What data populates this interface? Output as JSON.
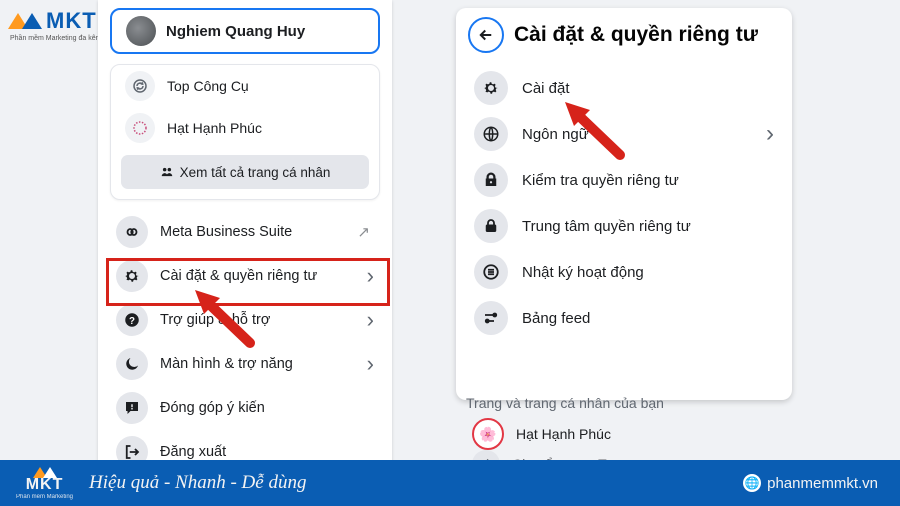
{
  "brand": {
    "name": "MKT",
    "sub": "Phần mềm Marketing đa kênh"
  },
  "left": {
    "profile_name": "Nghiem Quang Huy",
    "quick": [
      {
        "icon": "refresh-circle-icon",
        "label": "Top Công Cụ"
      },
      {
        "icon": "flower-moon-icon",
        "label": "Hạt Hạnh Phúc"
      }
    ],
    "all_profiles": "Xem tất cả trang cá nhân",
    "menu": [
      {
        "icon": "infinity-icon",
        "label": "Meta Business Suite",
        "external": "↗"
      },
      {
        "icon": "gear-icon",
        "label": "Cài đặt & quyền riêng tư",
        "chev": "›"
      },
      {
        "icon": "help-icon",
        "label": "Trợ giúp & hỗ trợ",
        "chev": "›"
      },
      {
        "icon": "moon-icon",
        "label": "Màn hình & trợ năng",
        "chev": "›"
      },
      {
        "icon": "feedback-icon",
        "label": "Đóng góp ý kiến"
      },
      {
        "icon": "logout-icon",
        "label": "Đăng xuất"
      }
    ]
  },
  "right": {
    "title": "Cài đặt & quyền riêng tư",
    "items": [
      {
        "icon": "gear-icon",
        "label": "Cài đặt"
      },
      {
        "icon": "globe-icon",
        "label": "Ngôn ngữ",
        "chev": "›"
      },
      {
        "icon": "lock-shield-icon",
        "label": "Kiểm tra quyền riêng tư"
      },
      {
        "icon": "lock-icon",
        "label": "Trung tâm quyền riêng tư"
      },
      {
        "icon": "list-icon",
        "label": "Nhật ký hoạt động"
      },
      {
        "icon": "sliders-icon",
        "label": "Bảng feed"
      }
    ]
  },
  "behind": {
    "line": "Trang và trang cá nhân của bạn",
    "row1": "Hạt Hạnh Phúc",
    "row2": "Chuyển sang Trang"
  },
  "footer": {
    "slogan": "Hiệu quả - Nhanh  - Dễ dùng",
    "site": "phanmemmkt.vn"
  }
}
